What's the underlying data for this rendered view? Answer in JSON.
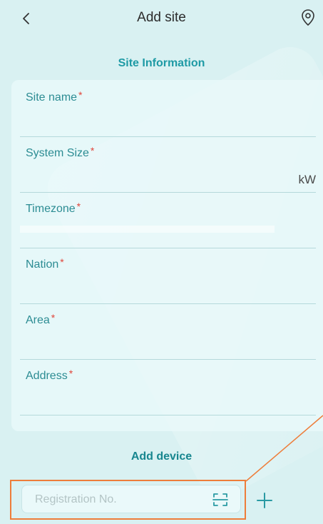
{
  "header": {
    "title": "Add site",
    "back_icon": "chevron-left-icon",
    "location_icon": "map-pin-icon"
  },
  "site_information": {
    "title": "Site Information",
    "fields": [
      {
        "label": "Site name",
        "required": "*",
        "value": ""
      },
      {
        "label": "System Size",
        "required": "*",
        "value": "",
        "unit": "kW"
      },
      {
        "label": "Timezone",
        "required": "*",
        "value": ""
      },
      {
        "label": "Nation",
        "required": "*",
        "value": ""
      },
      {
        "label": "Area",
        "required": "*",
        "value": ""
      },
      {
        "label": "Address",
        "required": "*",
        "value": ""
      }
    ]
  },
  "add_device": {
    "title": "Add device",
    "registration_placeholder": "Registration No.",
    "registration_value": "",
    "scan_icon": "scan-icon",
    "add_icon": "plus-icon"
  },
  "colors": {
    "background": "#d9f1f2",
    "accent": "#1e9aa5",
    "required": "#e0453a",
    "highlight": "#ee7d3a"
  }
}
